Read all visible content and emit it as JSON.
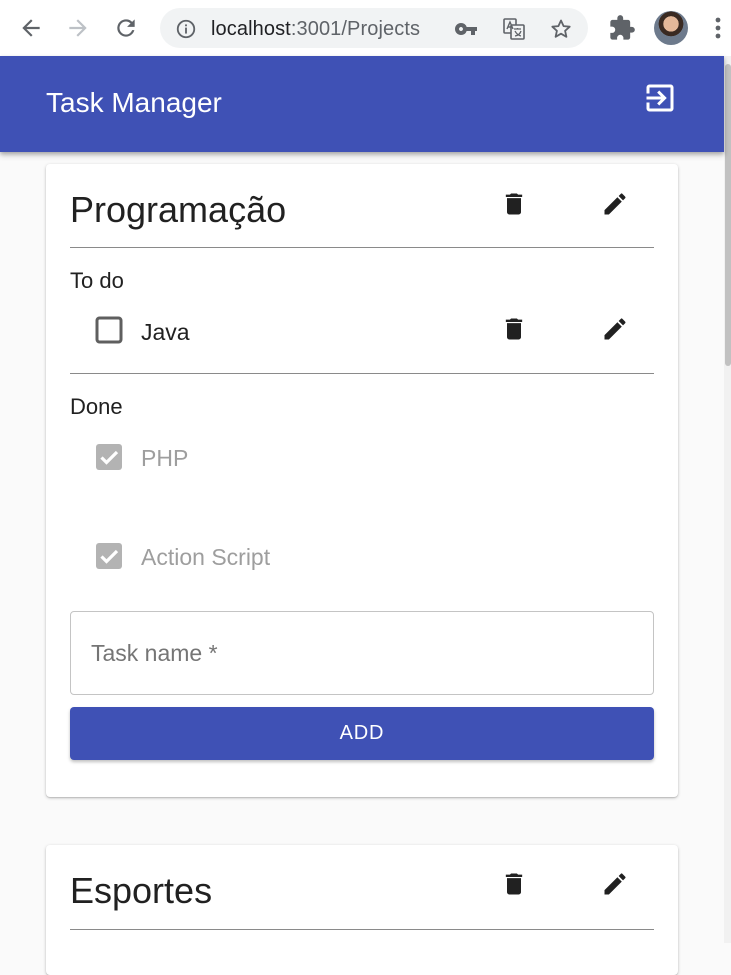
{
  "browser": {
    "url_host": "localhost",
    "url_path": ":3001/Projects"
  },
  "app": {
    "title": "Task Manager",
    "bar_color": "#3f51b5"
  },
  "projects": [
    {
      "title": "Programação",
      "todo_label": "To do",
      "todo": [
        {
          "name": "Java",
          "checked": false
        }
      ],
      "done_label": "Done",
      "done": [
        {
          "name": "PHP",
          "checked": true
        },
        {
          "name": "Action Script",
          "checked": true
        }
      ],
      "task_input": {
        "placeholder": "Task name *",
        "value": ""
      },
      "add_label": "ADD"
    },
    {
      "title": "Esportes"
    }
  ],
  "icons": {
    "back": "arrow-left-icon",
    "forward": "arrow-right-icon",
    "reload": "reload-icon",
    "info": "info-icon",
    "key": "key-icon",
    "translate": "translate-icon",
    "star": "star-icon",
    "extensions": "puzzle-icon",
    "menu": "kebab-menu-icon",
    "logout": "logout-icon",
    "delete": "trash-icon",
    "edit": "pencil-icon"
  }
}
